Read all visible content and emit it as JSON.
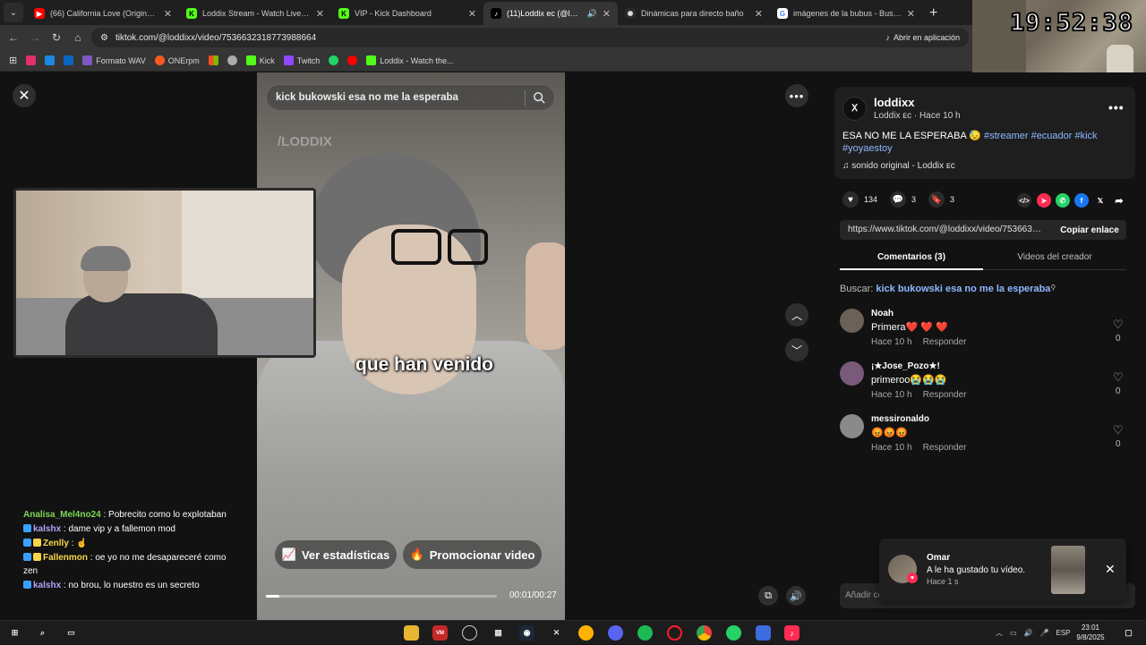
{
  "browser": {
    "tabs": [
      {
        "title": "(66) California Love (Original Ve",
        "icon": "youtube-icon",
        "color": "#ff0000",
        "active": false
      },
      {
        "title": "Loddix Stream - Watch Live on",
        "icon": "kick-icon",
        "color": "#53fc18",
        "active": false
      },
      {
        "title": "VIP - Kick Dashboard",
        "icon": "kick-icon",
        "color": "#53fc18",
        "active": false
      },
      {
        "title": "(11)Loddix ec (@loddixx) | T",
        "icon": "tiktok-icon",
        "color": "#ffffff",
        "active": true
      },
      {
        "title": "Dinámicas para directo baño",
        "icon": "openai-icon",
        "color": "#cccccc",
        "active": false
      },
      {
        "title": "imágenes de la bubus - Buscar",
        "icon": "google-icon",
        "color": "#4285f4",
        "active": false
      }
    ],
    "url": "tiktok.com/@loddixx/video/7536632318773988664",
    "open_in_app": "Abrir en aplicación",
    "bookmarks": [
      {
        "label": "",
        "color": "#e1306c"
      },
      {
        "label": "",
        "color": "#1e88e5"
      },
      {
        "label": "",
        "color": "#0a66c2"
      },
      {
        "label": "Formato WAV",
        "color": "#7e57c2"
      },
      {
        "label": "ONErpm",
        "color": "#ff5722"
      },
      {
        "label": "",
        "color": "#f25022"
      },
      {
        "label": "",
        "color": "#aaaaaa"
      },
      {
        "label": "Kick",
        "color": "#53fc18"
      },
      {
        "label": "Twitch",
        "color": "#9146ff"
      },
      {
        "label": "",
        "color": "#25d366"
      },
      {
        "label": "",
        "color": "#ff0000"
      },
      {
        "label": "Loddix - Watch the...",
        "color": "#53fc18"
      }
    ]
  },
  "overlay": {
    "clock": "19:52:38"
  },
  "video": {
    "search_text": "kick bukowski esa no me la esperaba",
    "watermark": "/LODDIX",
    "subtitle": "que han venido",
    "stats_button": "Ver estadísticas",
    "promote_button": "Promocionar video",
    "timecode": "00:01/00:27",
    "progress_fraction": 0.06
  },
  "chat": [
    {
      "user": "Analisa_Mel4no24",
      "text": ": Pobrecito como lo explotaban",
      "color": "#7ed957",
      "badge": ""
    },
    {
      "user": "kalshx",
      "text": ": dame vip y a fallemon mod",
      "color": "#b5a3ff",
      "badge": "#3aa0ff"
    },
    {
      "user": "Zenlly",
      "text": ": ☝",
      "color": "#f6d54a",
      "badge": "#3aa0ff"
    },
    {
      "user": "Fallenmon",
      "text": ": oe yo no me desapareceré como zen",
      "color": "#f6d54a",
      "badge": "#3aa0ff"
    },
    {
      "user": "kalshx",
      "text": ": no brou, lo nuestro es un secreto",
      "color": "#b5a3ff",
      "badge": "#3aa0ff"
    }
  ],
  "panel": {
    "creator_name": "loddixx",
    "creator_sub": "Loddix ᴇᴄ · Hace 10 h",
    "caption_text": "ESA NO ME LA ESPERABA 😓",
    "caption_tags": "#streamer #ecuador #kick #yoyaestoy",
    "sound": "sonido original - Loddix ᴇᴄ",
    "likes": "134",
    "comments": "3",
    "saves": "3",
    "share_link": "https://www.tiktok.com/@loddixx/video/7536632318773988664",
    "copy_link": "Copiar enlace",
    "tab_comments": "Comentarios (3)",
    "tab_videos": "Videos del creador",
    "search_label": "Buscar:",
    "search_query": "kick bukowski esa no me la esperaba",
    "add_comment_placeholder": "Añadir co",
    "comments_list": [
      {
        "name": "Noah",
        "text": "Primera❤️ ❤️ ❤️",
        "time": "Hace 10 h",
        "reply": "Responder",
        "likes": "0",
        "avatar": "#6b6156"
      },
      {
        "name": "¡★Jose_Pozo★!",
        "text": "primeroo😭😭😭",
        "time": "Hace 10 h",
        "reply": "Responder",
        "likes": "0",
        "avatar": "#7a5a7a"
      },
      {
        "name": "messironaldo",
        "text": "😡😡😡",
        "time": "Hace 10 h",
        "reply": "Responder",
        "likes": "0",
        "avatar": "#8a8a8a"
      }
    ]
  },
  "toast": {
    "name": "Omar",
    "message": "A le ha gustado tu vídeo.",
    "time": "Hace 1 s"
  },
  "taskbar": {
    "lang": "ESP",
    "time": "23:01",
    "date": "9/8/2025"
  }
}
